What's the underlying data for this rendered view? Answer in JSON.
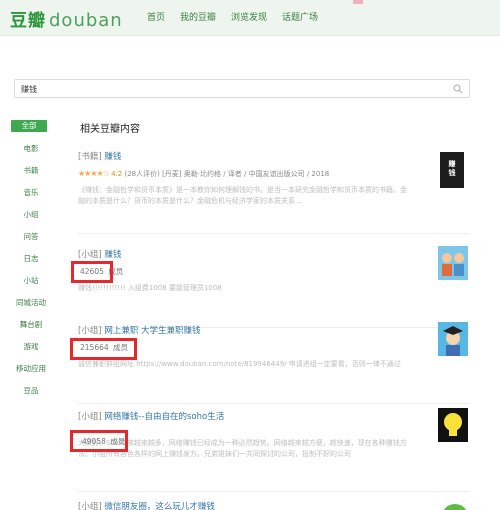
{
  "header": {
    "logo_cn": "豆瓣",
    "logo_en": "douban",
    "nav": [
      "首页",
      "我的豆瓣",
      "浏览发现",
      "话题广场"
    ]
  },
  "search": {
    "value": "赚钱"
  },
  "sidebar": {
    "items": [
      "全部",
      "电影",
      "书籍",
      "音乐",
      "小组",
      "问答",
      "日志",
      "小站",
      "同城活动",
      "舞台剧",
      "游戏",
      "移动应用",
      "豆品"
    ]
  },
  "main": {
    "section_title": "相关豆瓣内容",
    "results": [
      {
        "tag": "[书籍]",
        "title": "赚钱",
        "stars": "★★★★☆",
        "rating": "4.2",
        "rating_count": "(28人评价)",
        "meta": "[丹麦] 奥勒·比约格 / 译者 / 中国友谊出版公司 / 2018",
        "desc": "《赚钱：金融哲学和货币本质》是一本教你如何理解钱的书。是当一本研究金融哲学和货币本质的书籍。金融的本质是什么？货币的本质是什么？金融危机与经济学家的本质关系...",
        "book_text": "赚\n钱"
      },
      {
        "tag": "[小组]",
        "title": "赚钱",
        "count": "42605",
        "count_suffix": "成员",
        "desc": "赚钱!!!!!!!!!!!! 入组费1008 要能管理员1008"
      },
      {
        "tag": "[小组]",
        "title": "网上兼职 大学生兼职赚钱",
        "count": "215664",
        "count_suffix": "成员",
        "desc": "诚信兼职群组网址 https://www.douban.com/note/819946449/ 申请进组一定要看，否则一律不通过"
      },
      {
        "tag": "[小组]",
        "title": "网络赚钱--自由自在的soho生活",
        "count": "49058",
        "count_suffix": "成员",
        "desc": "大家好，SOHO族越来越多，网络赚钱已经成为一种必然趋势。网络越来越方便，越快速，现在各种赚钱方法。小组所有各色各样的网上赚钱发方。兄弟姐妹们一共同探讨的公司，抵制不好的公司"
      },
      {
        "tag": "[小组]",
        "title": "微信朋友圈，这么玩儿才赚钱"
      }
    ]
  },
  "colors": {
    "brand_green": "#2e963d",
    "link_blue": "#3377aa",
    "highlight_red": "#e3282e",
    "sidebar_active": "#3ea94f"
  }
}
